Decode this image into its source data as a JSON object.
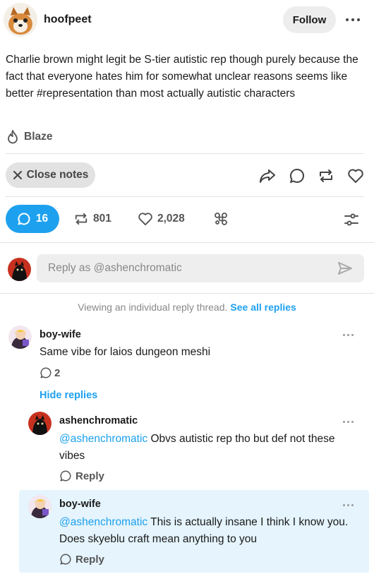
{
  "post": {
    "author": "hoofpeet",
    "follow_label": "Follow",
    "body": "Charlie brown might legit be S-tier autistic rep though purely because the fact that everyone hates him for somewhat unclear reasons seems like better #representation than most actually autistic characters",
    "blaze_label": "Blaze",
    "close_notes_label": "Close notes"
  },
  "stats": {
    "replies": "16",
    "reblogs": "801",
    "likes": "2,028"
  },
  "reply_box": {
    "placeholder": "Reply as @ashenchromatic"
  },
  "thread": {
    "info_text": "Viewing an individual reply thread.",
    "see_all_label": "See all replies",
    "hide_replies_label": "Hide replies",
    "replies": [
      {
        "author": "boy-wife",
        "text": "Same vibe for laios dungeon meshi",
        "reply_count": "2"
      },
      {
        "author": "ashenchromatic",
        "mention": "@ashenchromatic",
        "text": " Obvs autistic rep tho but def not these vibes",
        "reply_label": "Reply"
      },
      {
        "author": "boy-wife",
        "mention": "@ashenchromatic",
        "text": " This is actually insane I think I know you. Does skyeblu craft mean anything to you",
        "reply_label": "Reply"
      }
    ]
  },
  "colors": {
    "accent": "#1da1ef",
    "highlight_bg": "#e5f4fd",
    "pill_bg": "#ededed"
  },
  "icons": [
    "flame-icon",
    "close-icon",
    "share-icon",
    "comment-icon",
    "reblog-icon",
    "heart-icon",
    "notes-icon",
    "filter-icon",
    "send-icon",
    "more-icon"
  ]
}
